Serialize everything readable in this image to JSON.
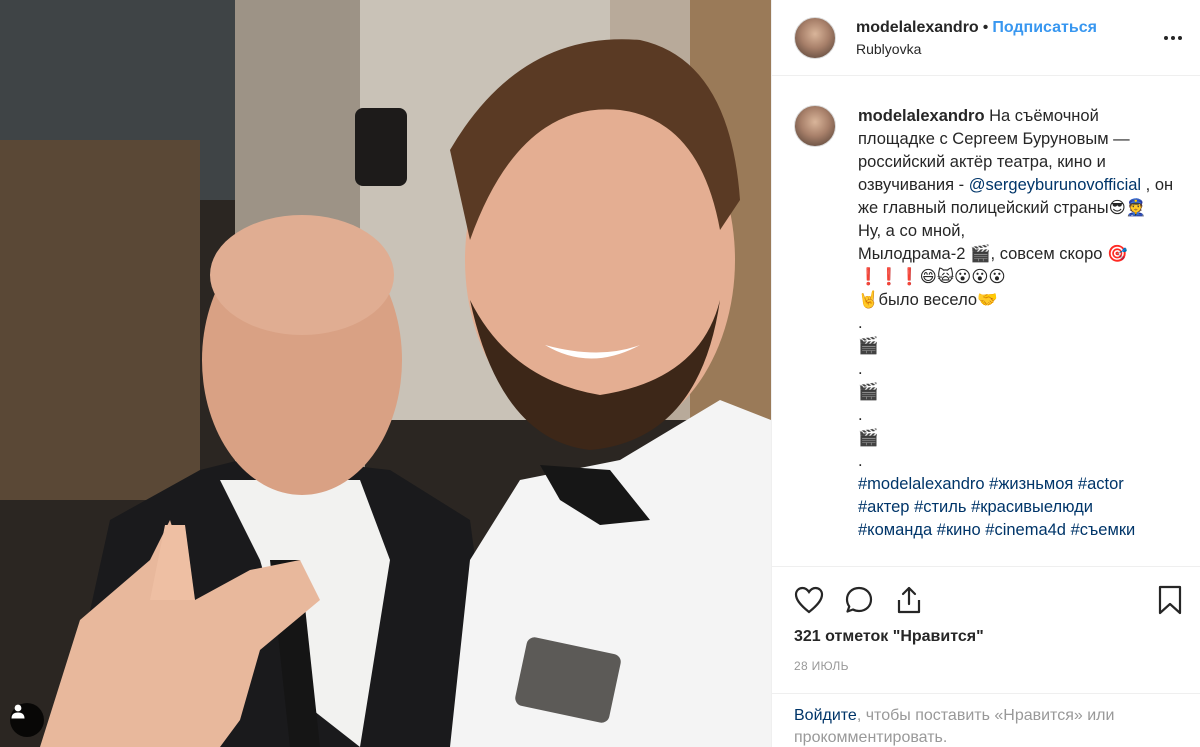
{
  "post": {
    "username": "modelalexandro",
    "separator": "•",
    "follow_label": "Подписаться",
    "location": "Rublyovka",
    "more_label": "•••"
  },
  "caption": {
    "username": "modelalexandro",
    "text_1": " На съёмочной площадке с Сергеем Буруновым — российский актёр театра, кино и озвучивания - ",
    "mention": "@sergeyburunovofficial",
    "text_2": " , он же главный полицейский страны😎👮\nНу, а со мной,\nМылодрама-2 🎬, совсем скоро 🎯\n❗❗❗😄🙀😮😮😮\n🤘было весело🤝\n.\n🎬\n.\n🎬\n.\n🎬\n.\n",
    "hashtags_line1": "#modelalexandro #жизньмоя #actor",
    "hashtags_line2": "#актер #стиль #красивыелюди",
    "hashtags_line3": "#команда #кино #cinema4d #съемки"
  },
  "actions": {
    "like_icon": "heart-icon",
    "comment_icon": "comment-icon",
    "share_icon": "share-icon",
    "save_icon": "bookmark-icon",
    "likes_text": "321 отметок \"Нравится\"",
    "date": "28 ИЮЛЬ"
  },
  "login_prompt": {
    "link": "Войдите",
    "text": ", чтобы поставить «Нравится» или прокомментировать."
  },
  "colors": {
    "accent": "#3897f0",
    "link": "#003569",
    "muted": "#999999",
    "border": "#efefef"
  }
}
